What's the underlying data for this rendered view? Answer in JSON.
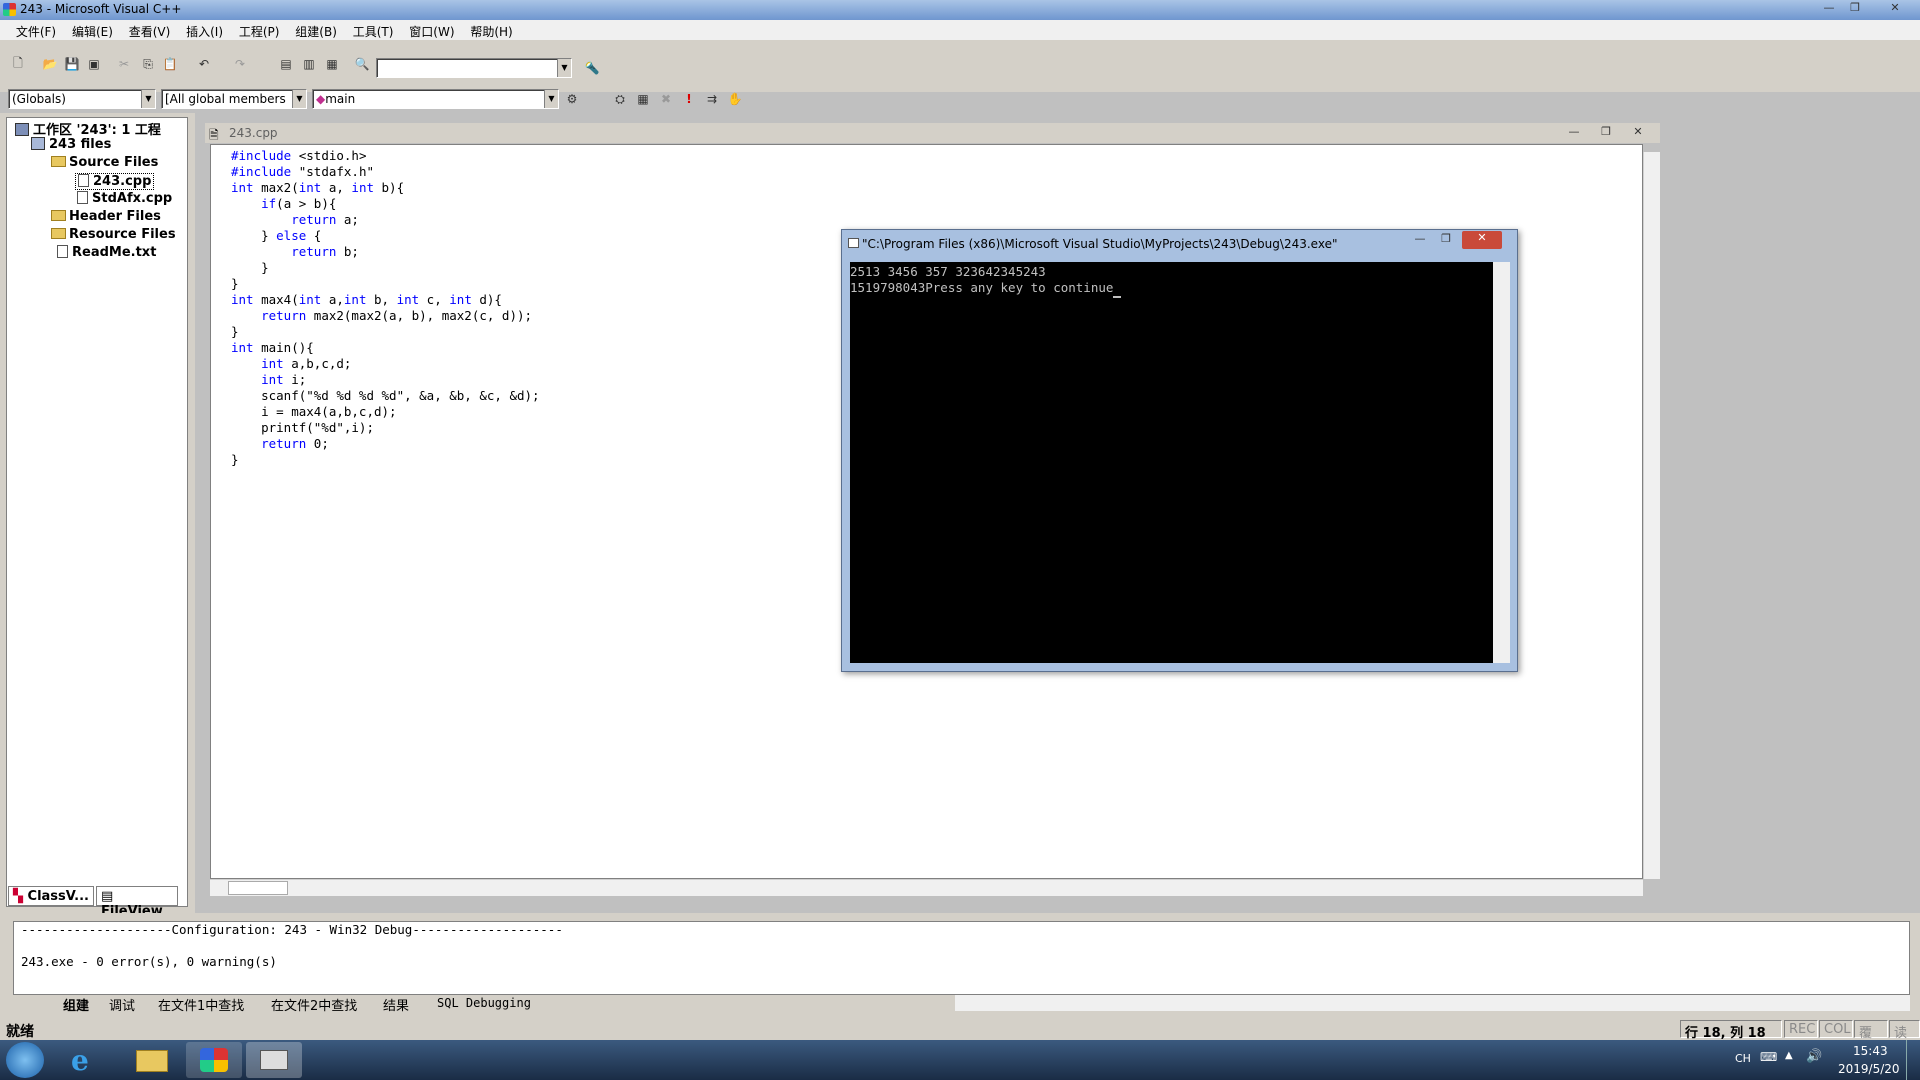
{
  "window": {
    "title": "243 - Microsoft Visual C++"
  },
  "menu": [
    "文件(F)",
    "编辑(E)",
    "查看(V)",
    "插入(I)",
    "工程(P)",
    "组建(B)",
    "工具(T)",
    "窗口(W)",
    "帮助(H)"
  ],
  "wizardbar": {
    "scope": "(Globals)",
    "filter": "[All global members",
    "function": "main"
  },
  "workspace": {
    "root": "工作区 '243': 1 工程",
    "project": "243 files",
    "items": [
      {
        "label": "Source Files"
      },
      {
        "label": "243.cpp"
      },
      {
        "label": "StdAfx.cpp"
      },
      {
        "label": "Header Files"
      },
      {
        "label": "Resource Files"
      },
      {
        "label": "ReadMe.txt"
      }
    ],
    "tabs": [
      "ClassV...",
      "FileView"
    ]
  },
  "editor": {
    "filename": "243.cpp",
    "code": [
      "#include <stdio.h>",
      "#include \"stdafx.h\"",
      "int max2(int a, int b){",
      "    if(a > b){",
      "        return a;",
      "    } else {",
      "        return b;",
      "    }",
      "}",
      "int max4(int a,int b, int c, int d){",
      "    return max2(max2(a, b), max2(c, d));",
      "}",
      "int main(){",
      "    int a,b,c,d;",
      "    int i;",
      "    scanf(\"%d %d %d %d\", &a, &b, &c, &d);",
      "    i = max4(a,b,c,d);",
      "    printf(\"%d\",i);",
      "    return 0;",
      "}"
    ]
  },
  "console": {
    "title": "\"C:\\Program Files (x86)\\Microsoft Visual Studio\\MyProjects\\243\\Debug\\243.exe\"",
    "lines": [
      "2513 3456 357 323642345243",
      "1519798043Press any key to continue"
    ]
  },
  "output": {
    "lines": [
      "--------------------Configuration: 243 - Win32 Debug--------------------",
      "",
      "243.exe - 0 error(s), 0 warning(s)"
    ],
    "tabs": [
      "组建",
      "调试",
      "在文件1中查找",
      "在文件2中查找",
      "结果",
      "SQL Debugging"
    ]
  },
  "status": {
    "ready": "就绪",
    "position": "行 18, 列 18",
    "rec": "REC",
    "col": "COL",
    "ovr": "覆盖",
    "read": "读取"
  },
  "tray": {
    "lang": "CH",
    "time": "15:43",
    "date": "2019/5/20"
  },
  "colors": {
    "keyword": "#0000ff",
    "console_bg": "#000000",
    "console_fg": "#c0c0c0",
    "chrome": "#d4d0c8"
  }
}
